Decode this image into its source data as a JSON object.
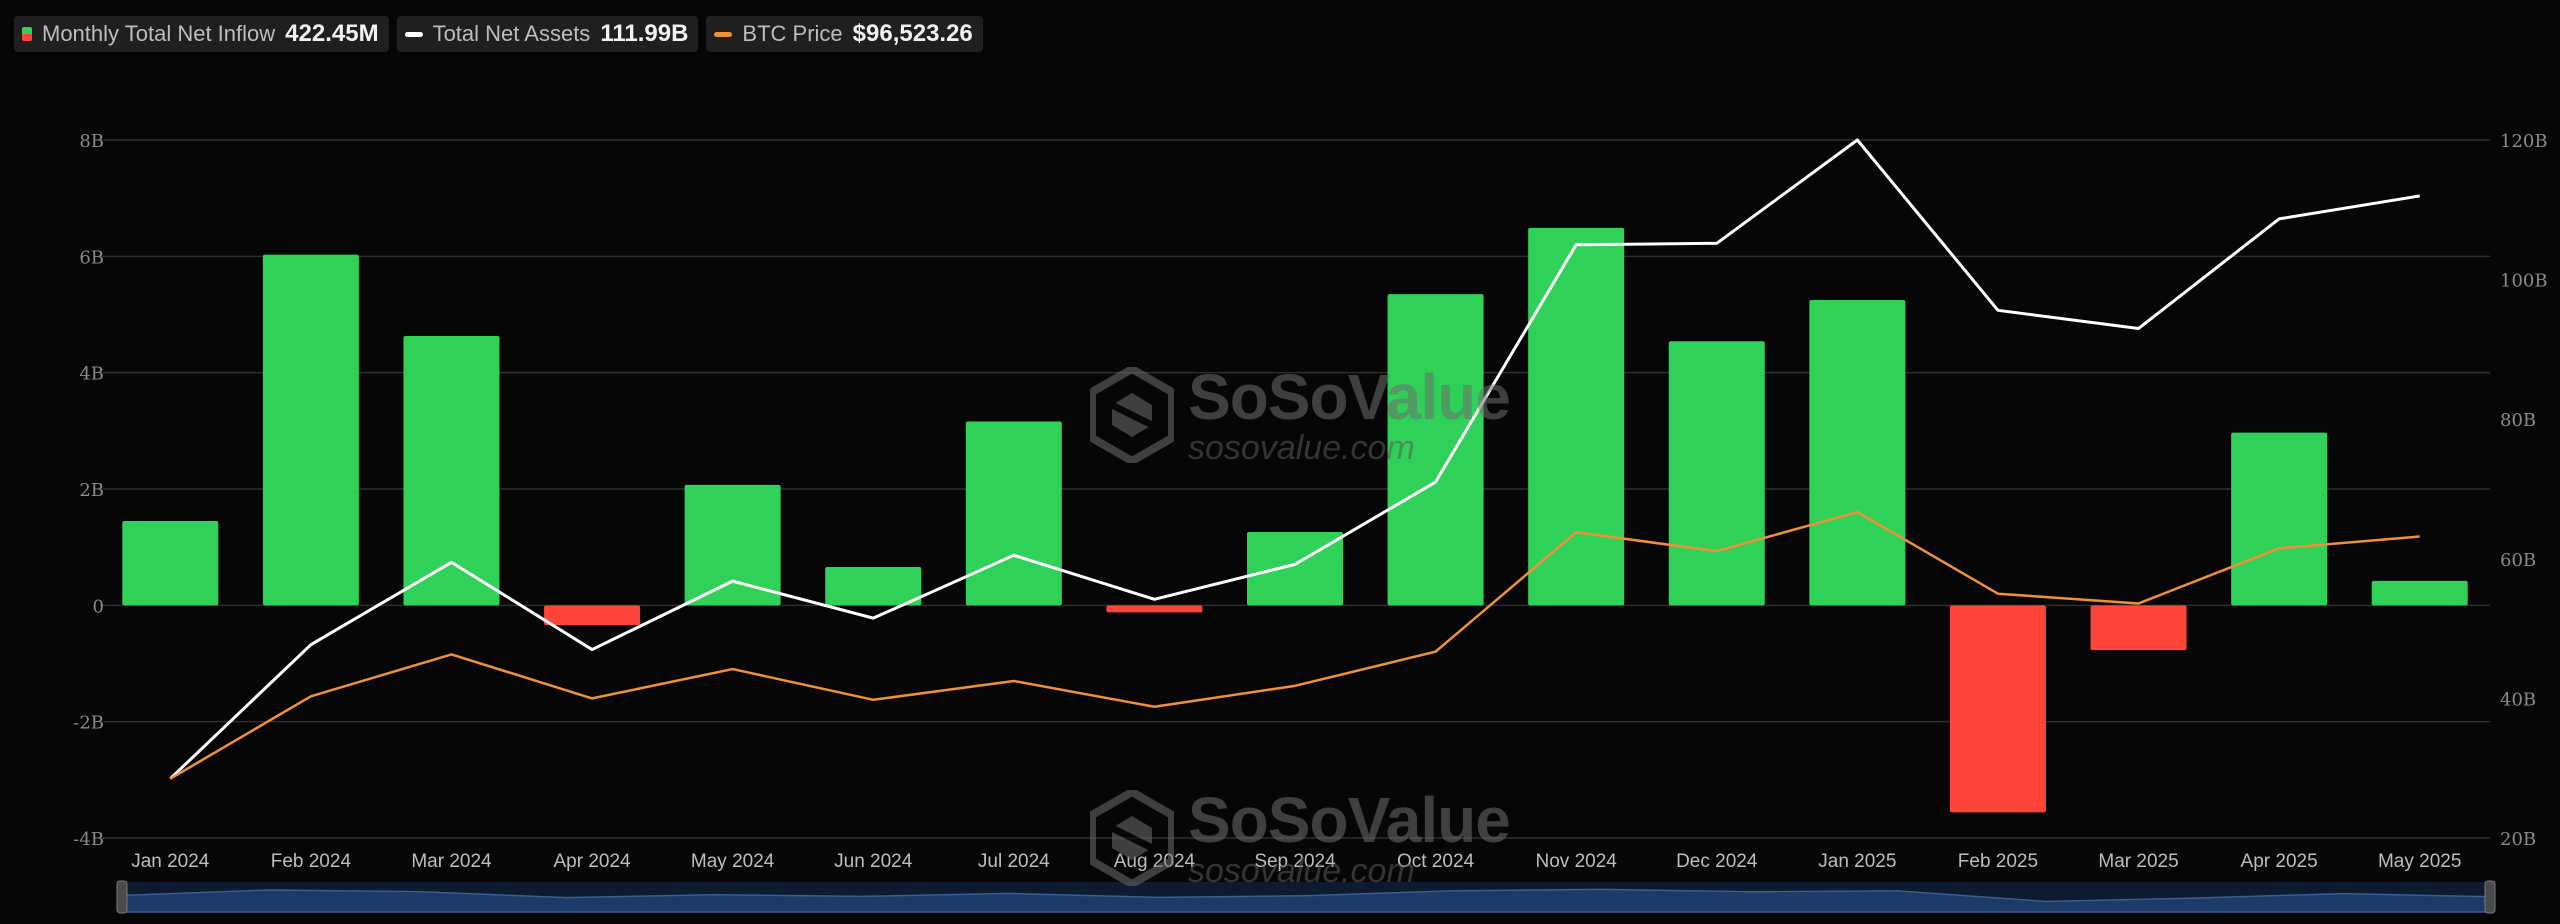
{
  "legend": {
    "inflow": {
      "label": "Monthly Total Net Inflow",
      "value": "422.45M"
    },
    "assets": {
      "label": "Total Net Assets",
      "value": "111.99B"
    },
    "price": {
      "label": "BTC Price",
      "value": "$96,523.26"
    }
  },
  "watermark": {
    "brand": "SoSoValue",
    "url": "sosovalue.com"
  },
  "colors": {
    "positive": "#30d158",
    "negative": "#ff453a",
    "assets_line": "#ffffff",
    "price_line": "#f0913a",
    "grid": "#2e2e2e",
    "navigator": "#1c3a68"
  },
  "chart_data": {
    "type": "bar",
    "categories": [
      "Jan 2024",
      "Feb 2024",
      "Mar 2024",
      "Apr 2024",
      "May 2024",
      "Jun 2024",
      "Jul 2024",
      "Aug 2024",
      "Sep 2024",
      "Oct 2024",
      "Nov 2024",
      "Dec 2024",
      "Jan 2025",
      "Feb 2025",
      "Mar 2025",
      "Apr 2025",
      "May 2025"
    ],
    "left_axis": {
      "ylim": [
        -4,
        8
      ],
      "ticks": [
        -4,
        -2,
        0,
        2,
        4,
        6,
        8
      ],
      "tick_labels": [
        "-4B",
        "-2B",
        "0",
        "2B",
        "4B",
        "6B",
        "8B"
      ]
    },
    "right_axis": {
      "ylim": [
        20,
        120
      ],
      "ticks": [
        20,
        40,
        60,
        80,
        100,
        120
      ],
      "tick_labels": [
        "20B",
        "40B",
        "60B",
        "80B",
        "100B",
        "120B"
      ]
    },
    "grid": true,
    "series": [
      {
        "name": "Monthly Total Net Inflow",
        "type": "bar",
        "axis": "left",
        "values": [
          1.45,
          6.03,
          4.63,
          -0.34,
          2.07,
          0.66,
          3.16,
          -0.12,
          1.26,
          5.35,
          6.49,
          4.54,
          5.25,
          -3.56,
          -0.77,
          2.97,
          0.42
        ]
      },
      {
        "name": "Total Net Assets",
        "type": "line",
        "axis": "right",
        "values": [
          28.5,
          47.7,
          59.5,
          47.0,
          56.8,
          51.5,
          60.5,
          54.2,
          59.2,
          71.0,
          105.0,
          105.2,
          120.0,
          95.6,
          93.0,
          108.7,
          111.99
        ]
      },
      {
        "name": "BTC Price",
        "type": "line",
        "axis": "right",
        "values": [
          28.5,
          40.3,
          46.3,
          40.0,
          44.2,
          39.8,
          42.5,
          38.8,
          41.8,
          46.7,
          63.8,
          61.1,
          66.7,
          55.0,
          53.6,
          61.5,
          63.2
        ]
      }
    ],
    "navigator": {
      "values": [
        1.45,
        6.03,
        4.63,
        -0.34,
        2.07,
        0.66,
        3.16,
        -0.12,
        1.26,
        5.35,
        6.49,
        4.54,
        5.25,
        -3.56,
        -0.77,
        2.97,
        0.42
      ]
    }
  }
}
